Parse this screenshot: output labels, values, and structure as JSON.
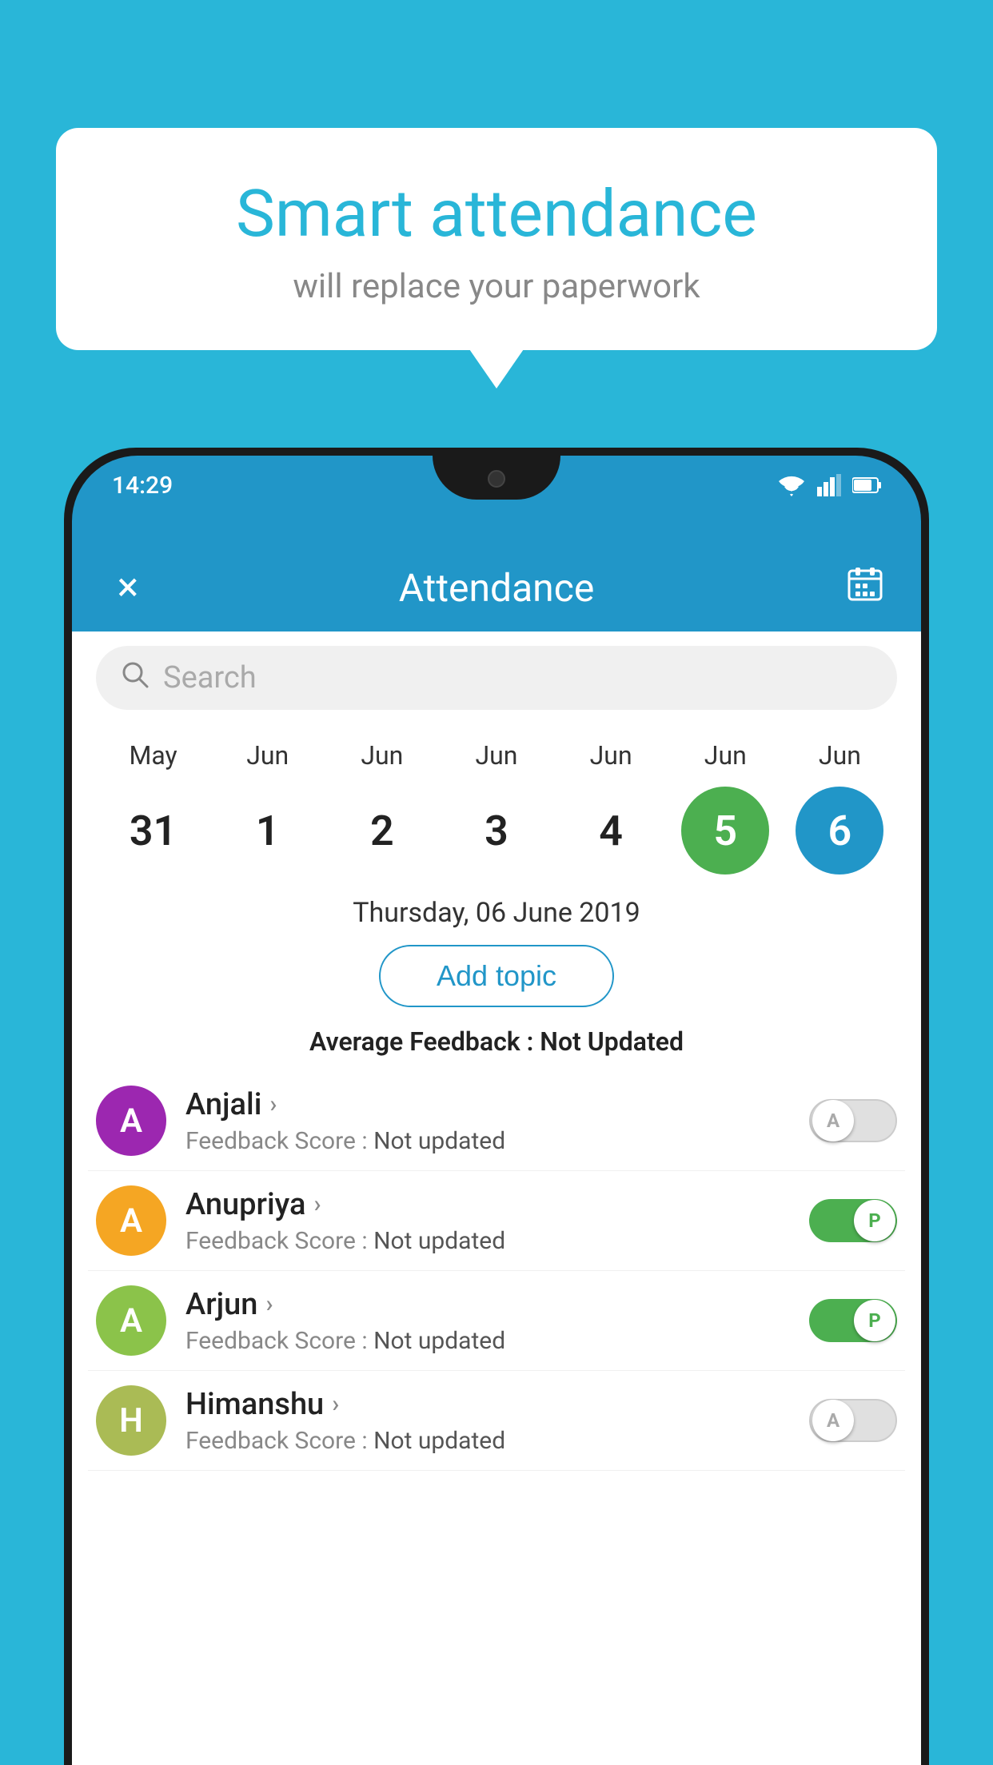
{
  "background_color": "#29b6d8",
  "bubble": {
    "title": "Smart attendance",
    "subtitle": "will replace your paperwork"
  },
  "status_bar": {
    "time": "14:29",
    "wifi_icon": "wifi",
    "signal_icon": "signal",
    "battery_icon": "battery"
  },
  "app_bar": {
    "title": "Attendance",
    "close_label": "×",
    "calendar_label": "📅"
  },
  "search": {
    "placeholder": "Search"
  },
  "calendar": {
    "days": [
      {
        "month": "May",
        "date": "31",
        "state": "normal"
      },
      {
        "month": "Jun",
        "date": "1",
        "state": "normal"
      },
      {
        "month": "Jun",
        "date": "2",
        "state": "normal"
      },
      {
        "month": "Jun",
        "date": "3",
        "state": "normal"
      },
      {
        "month": "Jun",
        "date": "4",
        "state": "normal"
      },
      {
        "month": "Jun",
        "date": "5",
        "state": "green"
      },
      {
        "month": "Jun",
        "date": "6",
        "state": "blue"
      }
    ]
  },
  "selected_date": "Thursday, 06 June 2019",
  "add_topic_label": "Add topic",
  "avg_feedback_label": "Average Feedback :",
  "avg_feedback_value": "Not Updated",
  "students": [
    {
      "name": "Anjali",
      "avatar_letter": "A",
      "avatar_color": "#9c27b0",
      "feedback": "Feedback Score : Not updated",
      "toggle_state": "off",
      "toggle_letter": "A"
    },
    {
      "name": "Anupriya",
      "avatar_letter": "A",
      "avatar_color": "#f5a623",
      "feedback": "Feedback Score : Not updated",
      "toggle_state": "on",
      "toggle_letter": "P"
    },
    {
      "name": "Arjun",
      "avatar_letter": "A",
      "avatar_color": "#8bc34a",
      "feedback": "Feedback Score : Not updated",
      "toggle_state": "on",
      "toggle_letter": "P"
    },
    {
      "name": "Himanshu",
      "avatar_letter": "H",
      "avatar_color": "#aabb55",
      "feedback": "Feedback Score : Not updated",
      "toggle_state": "off",
      "toggle_letter": "A"
    }
  ]
}
